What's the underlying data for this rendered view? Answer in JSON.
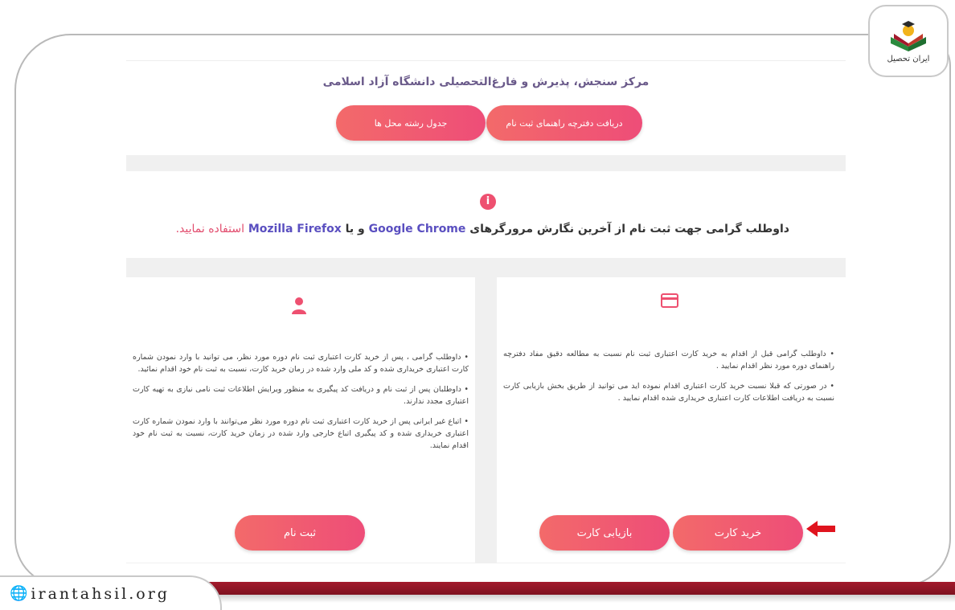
{
  "brand": {
    "url": "irantahsil.org",
    "logo_text": "ایران تحصیل",
    "accent": "#a31a2c"
  },
  "top": {
    "title": "مرکز سنجش، پذیرش و فارغ‌التحصیلی دانشگاه آزاد اسلامی",
    "btn_guide": "دریافت دفترچه راهنمای ثبت نام",
    "btn_table": "جدول رشته محل ها"
  },
  "notice": {
    "prefix": "داوطلب گرامی جهت ثبت نام از آخرین نگارش مرورگرهای",
    "chrome": "Google Chrome",
    "and_or": "و یا",
    "firefox": "Mozilla Firefox",
    "suffix": "استفاده نمایید."
  },
  "card_panel": {
    "icon": "credit-card-icon",
    "para1": "• داوطلب گرامی قبل از اقدام به خرید کارت اعتباری ثبت نام نسبت به مطالعه دقیق مفاد دفترچه راهنمای دوره مورد نظر اقدام نمایید .",
    "para2": "• در صورتی که قبلا نسبت خرید کارت اعتباری اقدام نموده اید می توانید از طریق بخش بازیابی کارت نسبت به دریافت اطلاعات کارت اعتباری خریداری شده اقدام نمایید .",
    "btn_buy": "خرید کارت",
    "btn_recover": "بازیابی کارت"
  },
  "user_panel": {
    "icon": "user-icon",
    "para1": "• داوطلب گرامی ، پس از خرید کارت اعتباری ثبت نام دوره مورد نظر، می توانید با وارد نمودن شماره کارت اعتباری خریداری شده و کد ملی وارد شده در زمان خرید کارت، نسبت به ثبت نام خود اقدام نمائید.",
    "para2": "• داوطلبان پس از ثبت نام و دریافت کد پیگیری به منظور ویرایش اطلاعات ثبت نامی نیازی به تهیه کارت اعتباری مجدد ندارند.",
    "para3": "• اتباع غیر ایرانی پس از خرید کارت اعتباری ثبت نام دوره مورد نظر می‌توانند با وارد نمودن شماره کارت اعتباری خریداری شده و کد پیگیری اتباع خارجی وارد شده در زمان خرید کارت، نسبت به ثبت نام خود اقدام نمایند.",
    "btn_register": "ثبت نام"
  }
}
